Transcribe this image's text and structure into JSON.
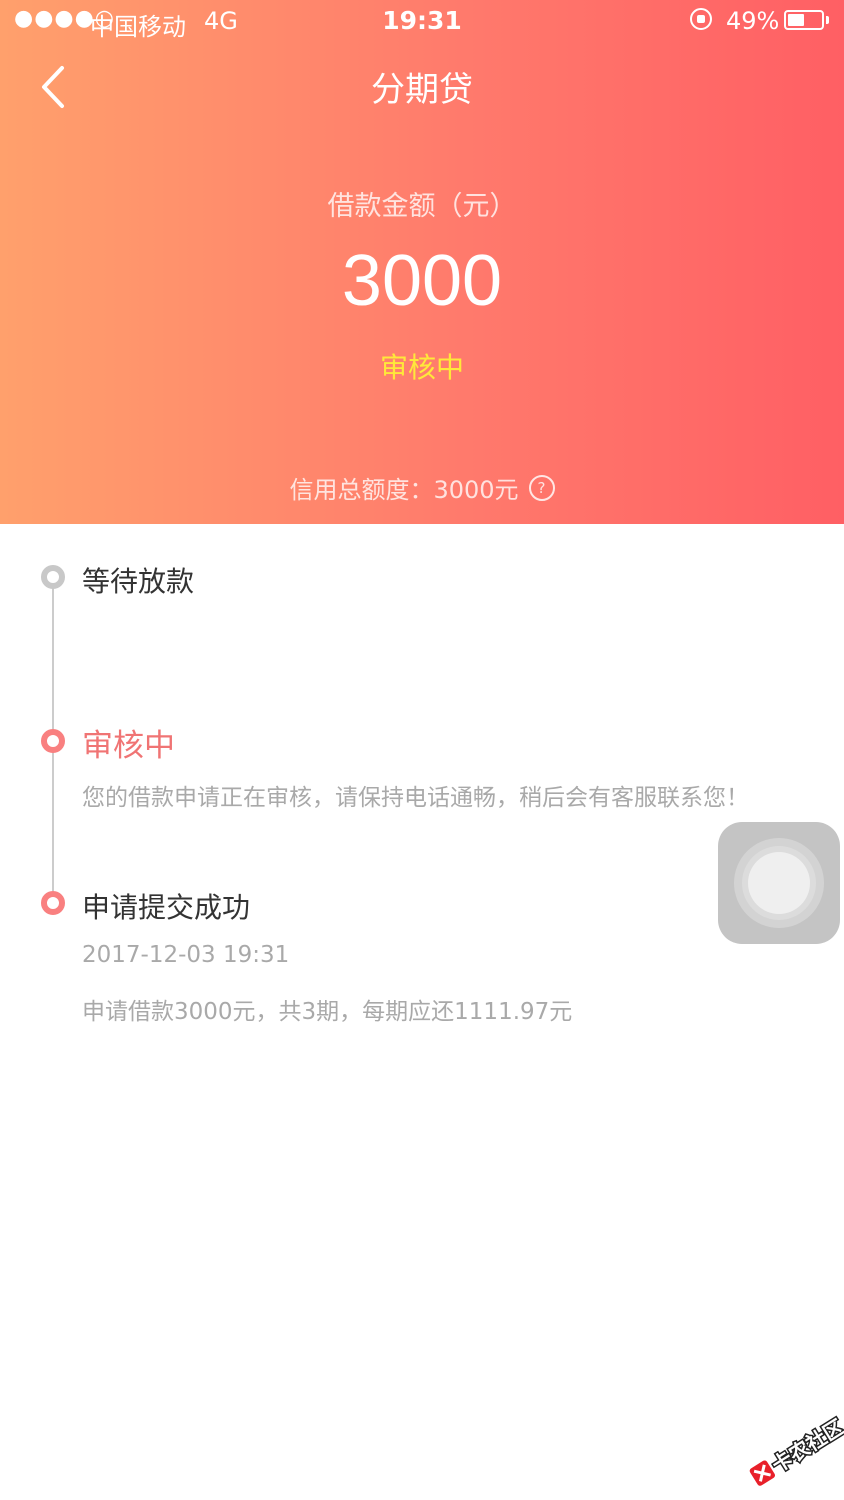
{
  "status_bar": {
    "signal": "●●●●○",
    "carrier": "中国移动",
    "network": "4G",
    "time": "19:31",
    "battery_percent": "49%",
    "battery_level": 0.49
  },
  "nav": {
    "back_icon": "chevron-left-icon",
    "title": "分期贷"
  },
  "loan": {
    "amount_label": "借款金额（元）",
    "amount": "3000",
    "status": "审核中",
    "credit_limit": "信用总额度：3000元",
    "help_icon": "question-circle-icon"
  },
  "timeline": {
    "steps": [
      {
        "title": "等待放款"
      },
      {
        "title": "审核中",
        "desc": "您的借款申请正在审核，请保持电话通畅，稍后会有客服联系您！"
      },
      {
        "title": "申请提交成功",
        "time": "2017-12-03 19:31",
        "desc": "申请借款3000元，共3期，每期应还1111.97元"
      }
    ]
  },
  "watermark": "卡农社区",
  "colors": {
    "header_start": "#ffa06c",
    "header_end": "#ff5f64",
    "status_yellow": "#ffe83a",
    "accent_red": "#f07474",
    "inactive_grey": "#c8c8c8"
  }
}
